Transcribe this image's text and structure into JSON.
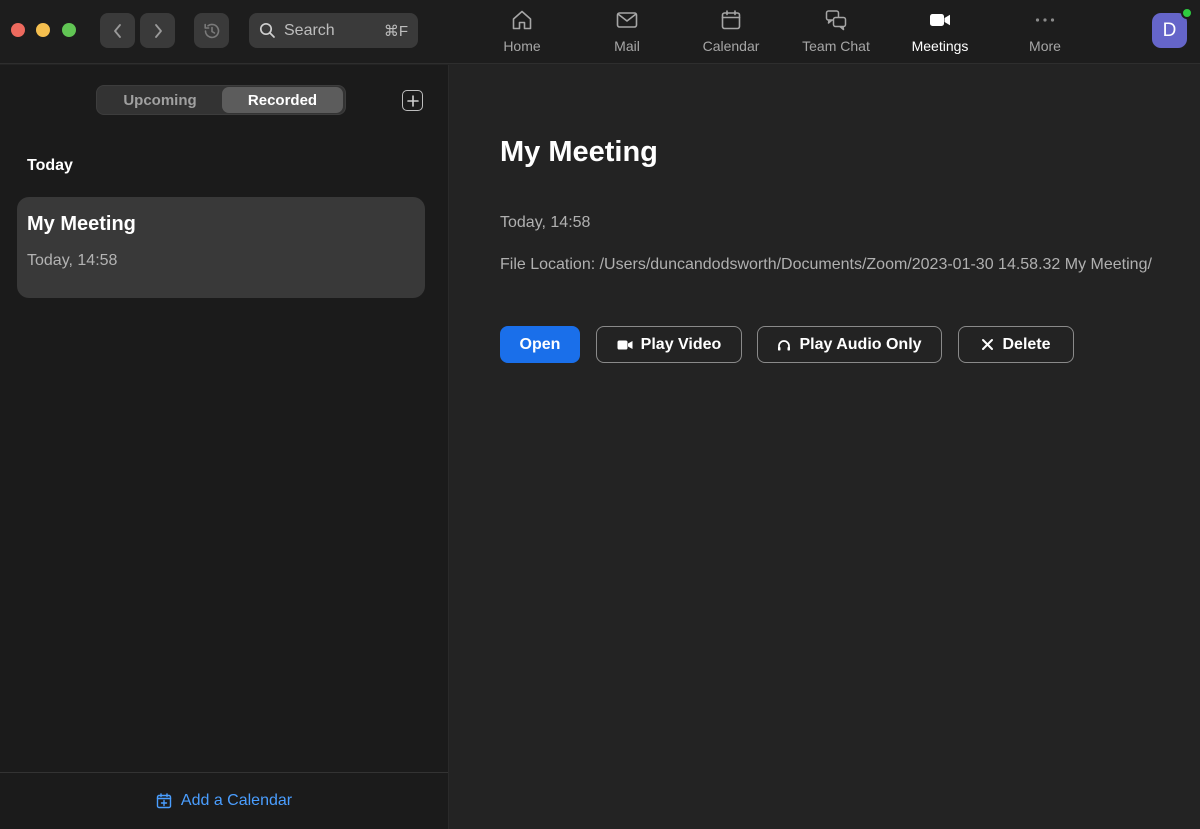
{
  "window": {
    "search": {
      "placeholder": "Search",
      "shortcut": "⌘F"
    },
    "tabs": [
      {
        "label": "Home",
        "icon": "home-icon"
      },
      {
        "label": "Mail",
        "icon": "mail-icon"
      },
      {
        "label": "Calendar",
        "icon": "calendar-icon"
      },
      {
        "label": "Team Chat",
        "icon": "chat-icon"
      },
      {
        "label": "Meetings",
        "icon": "video-camera-icon",
        "active": true
      },
      {
        "label": "More",
        "icon": "more-dots-icon"
      }
    ],
    "avatar": {
      "initial": "D"
    }
  },
  "sidebar": {
    "segments": {
      "upcoming": "Upcoming",
      "recorded": "Recorded",
      "selected": "Recorded"
    },
    "section_title": "Today",
    "items": [
      {
        "title": "My Meeting",
        "time": "Today, 14:58"
      }
    ],
    "footer": {
      "add_calendar": "Add a Calendar"
    }
  },
  "detail": {
    "title": "My Meeting",
    "time": "Today, 14:58",
    "file_location": "File Location: /Users/duncandodsworth/Documents/Zoom/2023-01-30 14.58.32 My Meeting/",
    "actions": {
      "open": "Open",
      "play_video": "Play Video",
      "play_audio": "Play Audio Only",
      "delete": "Delete"
    }
  },
  "colors": {
    "accent": "#1a6fea",
    "link": "#4a9eff",
    "avatar": "#6565c9",
    "presence": "#2ecc40"
  }
}
